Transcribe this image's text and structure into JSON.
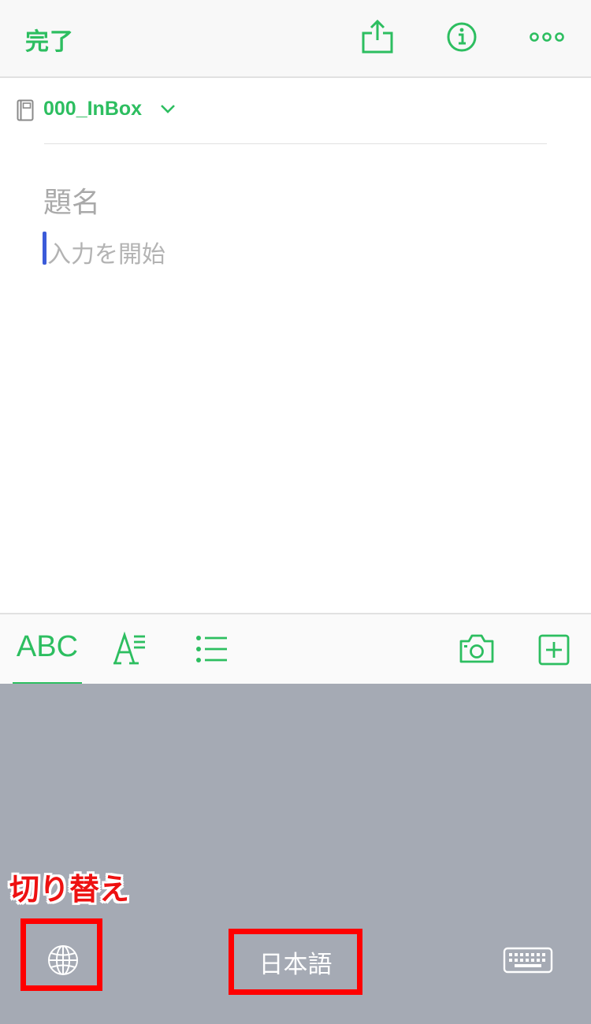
{
  "topbar": {
    "done_label": "完了",
    "icons": [
      "share-icon",
      "info-icon",
      "more-icon"
    ]
  },
  "notebook": {
    "name": "000_InBox",
    "icon": "notebook-icon"
  },
  "editor": {
    "title_placeholder": "題名",
    "body_placeholder": "入力を開始"
  },
  "format_bar": {
    "active_tab": "ABC",
    "icons": [
      "text-format-icon",
      "list-icon",
      "camera-icon",
      "add-icon"
    ]
  },
  "keyboard": {
    "annotation": "切り替え",
    "language_label": "日本語",
    "icons": [
      "globe-icon",
      "keyboard-hide-icon"
    ]
  },
  "colors": {
    "accent": "#2dbe60",
    "keyboard_bg": "#a5aab4",
    "highlight": "#ff0000",
    "cursor": "#3b5bd9"
  }
}
